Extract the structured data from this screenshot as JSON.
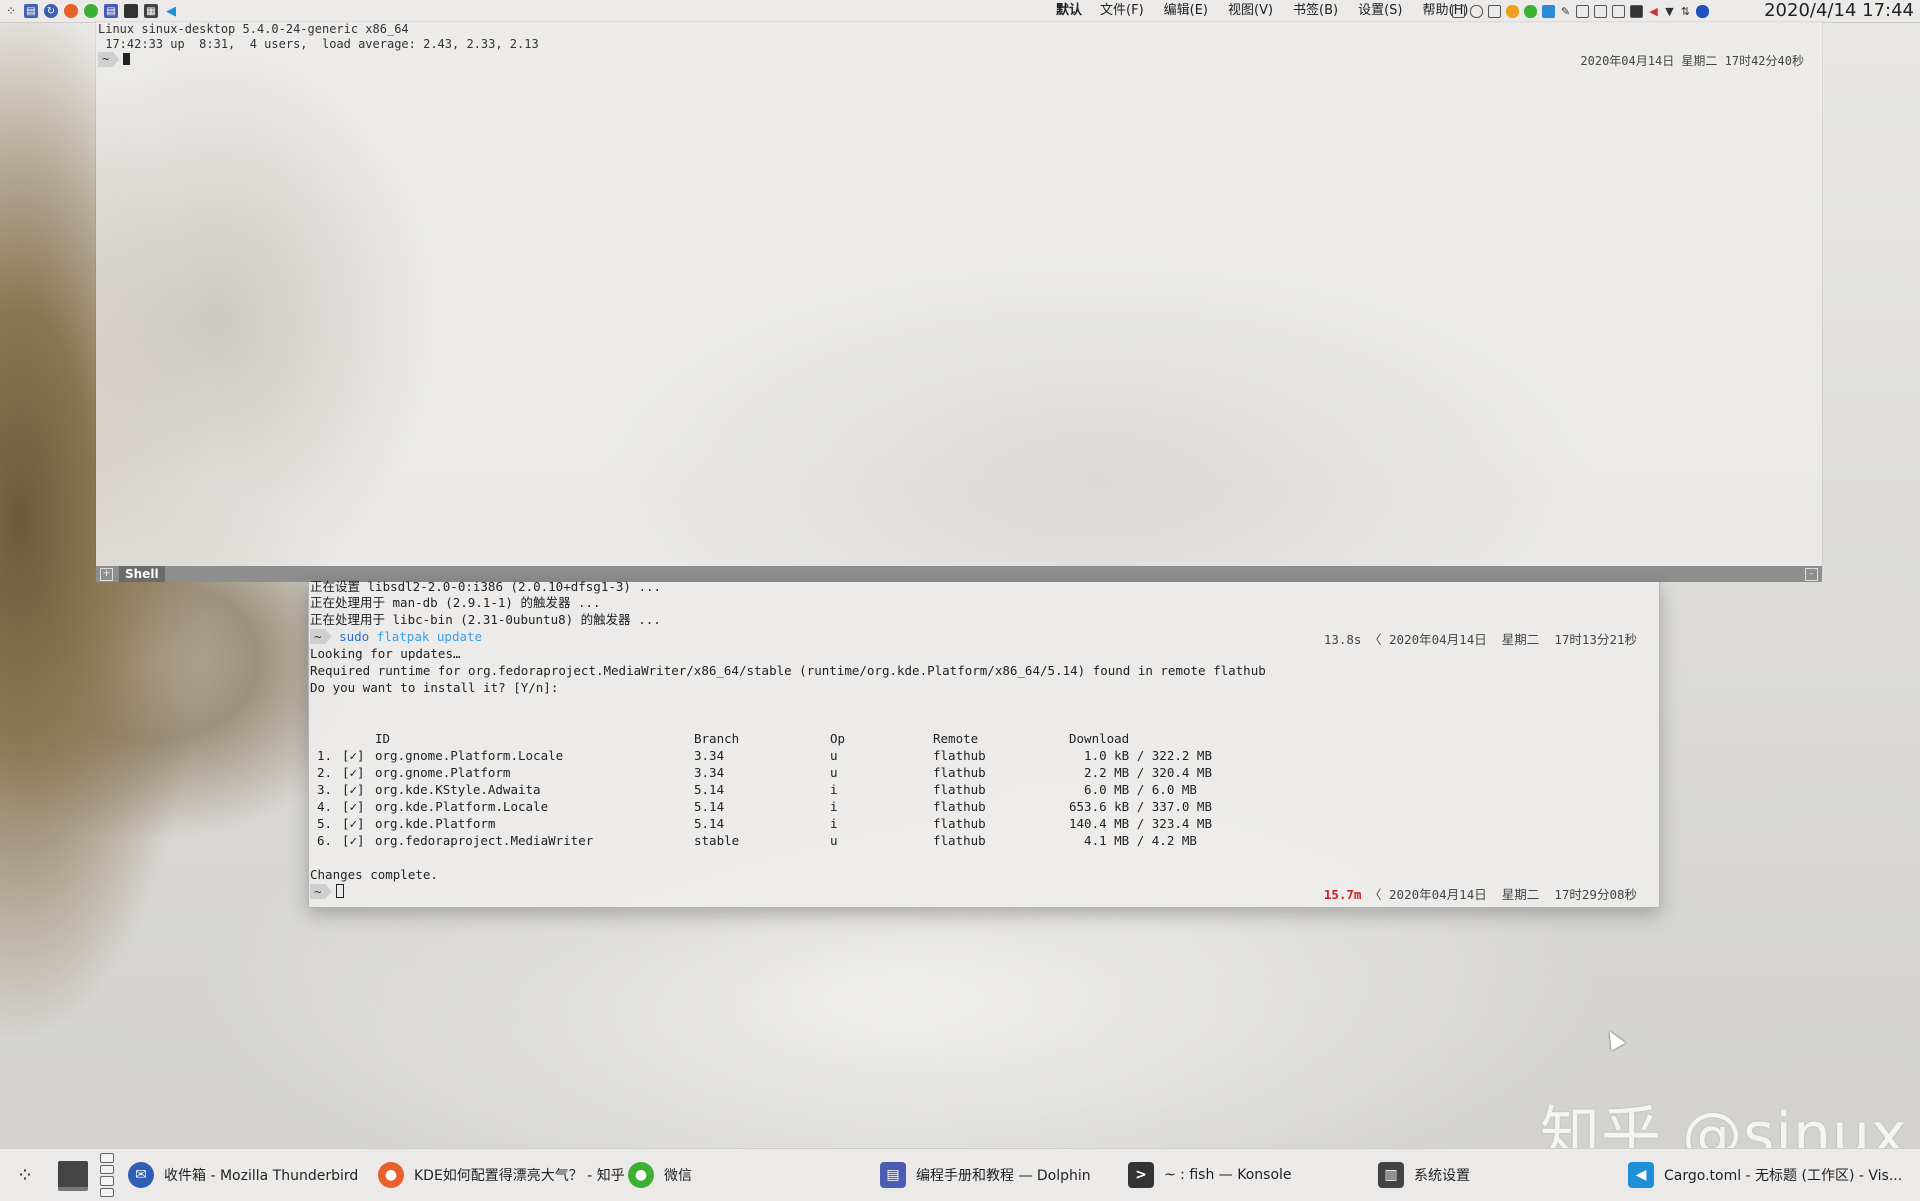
{
  "top_panel": {
    "menus": [
      "默认",
      "文件(F)",
      "编辑(E)",
      "视图(V)",
      "书签(B)",
      "设置(S)",
      "帮助(H)"
    ],
    "clock": "2020/4/14 17:44",
    "launcher_icons": [
      "kde-start-icon",
      "window-list-icon",
      "sync-icon",
      "firefox-icon",
      "wechat-icon",
      "notes-icon",
      "terminal-icon",
      "calculator-icon",
      "vscode-icon"
    ]
  },
  "yakuake": {
    "lines": [
      "Linux sinux-desktop 5.4.0-24-generic x86_64",
      " 17:42:33 up  8:31,  4 users,  load average: 2.43, 2.33, 2.13"
    ],
    "prompt": "~",
    "datetime": "2020年04月14日 星期二 17时42分40秒",
    "tab_label": "Shell"
  },
  "konsole": {
    "top_lines": [
      "正在设置 libsdl2-2.0-0:i386 (2.0.10+dfsg1-3) ...",
      "正在处理用于 man-db (2.9.1-1) 的触发器 ...",
      "正在处理用于 libc-bin (2.31-0ubuntu8) 的触发器 ..."
    ],
    "prompt": "~",
    "cmd_sudo": "sudo",
    "cmd_args": "flatpak update",
    "first_timing": "13.8s",
    "first_datetime": "2020年04月14日  星期二  17时13分21秒",
    "msg_lines": [
      "Looking for updates…",
      "Required runtime for org.fedoraproject.MediaWriter/x86_64/stable (runtime/org.kde.Platform/x86_64/5.14) found in remote flathub",
      "Do you want to install it? [Y/n]:"
    ],
    "table_headers": [
      "ID",
      "Branch",
      "Op",
      "Remote",
      "Download"
    ],
    "rows": [
      {
        "num": "1.",
        "chk": "[✓]",
        "id": "org.gnome.Platform.Locale",
        "branch": "3.34",
        "op": "u",
        "remote": "flathub",
        "dl": "  1.0 kB / 322.2 MB"
      },
      {
        "num": "2.",
        "chk": "[✓]",
        "id": "org.gnome.Platform",
        "branch": "3.34",
        "op": "u",
        "remote": "flathub",
        "dl": "  2.2 MB / 320.4 MB"
      },
      {
        "num": "3.",
        "chk": "[✓]",
        "id": "org.kde.KStyle.Adwaita",
        "branch": "5.14",
        "op": "i",
        "remote": "flathub",
        "dl": "  6.0 MB / 6.0 MB"
      },
      {
        "num": "4.",
        "chk": "[✓]",
        "id": "org.kde.Platform.Locale",
        "branch": "5.14",
        "op": "i",
        "remote": "flathub",
        "dl": "653.6 kB / 337.0 MB"
      },
      {
        "num": "5.",
        "chk": "[✓]",
        "id": "org.kde.Platform",
        "branch": "5.14",
        "op": "i",
        "remote": "flathub",
        "dl": "140.4 MB / 323.4 MB"
      },
      {
        "num": "6.",
        "chk": "[✓]",
        "id": "org.fedoraproject.MediaWriter",
        "branch": "stable",
        "op": "u",
        "remote": "flathub",
        "dl": "  4.1 MB / 4.2 MB"
      }
    ],
    "done": "Changes complete.",
    "second_timing": "15.7m",
    "second_datetime": "2020年04月14日  星期二  17时29分08秒"
  },
  "watermark": "知乎 @sinux",
  "taskbar": {
    "tasks": [
      {
        "label": "收件箱 - Mozilla Thunderbird",
        "color": "#2f5fb3",
        "glyph": "✉"
      },
      {
        "label": "KDE如何配置得漂亮大气？ - 知乎 ...",
        "color": "#e8602a",
        "glyph": "●"
      },
      {
        "label": "微信",
        "color": "#3cb034",
        "glyph": "●"
      },
      {
        "label": "编程手册和教程 — Dolphin",
        "color": "#4a5db3",
        "glyph": "▤"
      },
      {
        "label": "~ : fish — Konsole",
        "color": "#333333",
        "glyph": ">"
      },
      {
        "label": "系统设置",
        "color": "#444444",
        "glyph": "▥"
      },
      {
        "label": "Cargo.toml - 无标题 (工作区) - Vis...",
        "color": "#1e90d8",
        "glyph": "◀"
      }
    ]
  }
}
